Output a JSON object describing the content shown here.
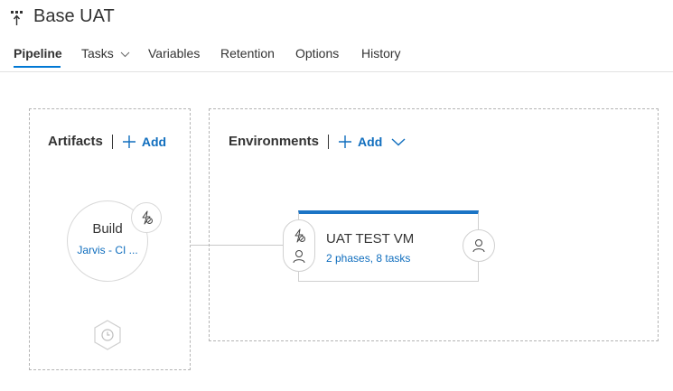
{
  "header": {
    "title": "Base UAT",
    "icon": "release-pipeline-icon"
  },
  "tabs": [
    {
      "label": "Pipeline",
      "selected": true
    },
    {
      "label": "Tasks",
      "has_dropdown": true
    },
    {
      "label": "Variables"
    },
    {
      "label": "Retention"
    },
    {
      "label": "Options"
    },
    {
      "label": "History"
    }
  ],
  "artifacts": {
    "heading": "Artifacts",
    "add_label": "Add",
    "items": [
      {
        "name": "Build",
        "source": "Jarvis - CI ..."
      }
    ]
  },
  "environments": {
    "heading": "Environments",
    "add_label": "Add",
    "items": [
      {
        "name": "UAT TEST VM",
        "summary": "2 phases, 8 tasks"
      }
    ]
  },
  "colors": {
    "accent": "#1b74c5",
    "link": "#106ebe",
    "border": "#d0d0d0",
    "text": "#333333"
  }
}
